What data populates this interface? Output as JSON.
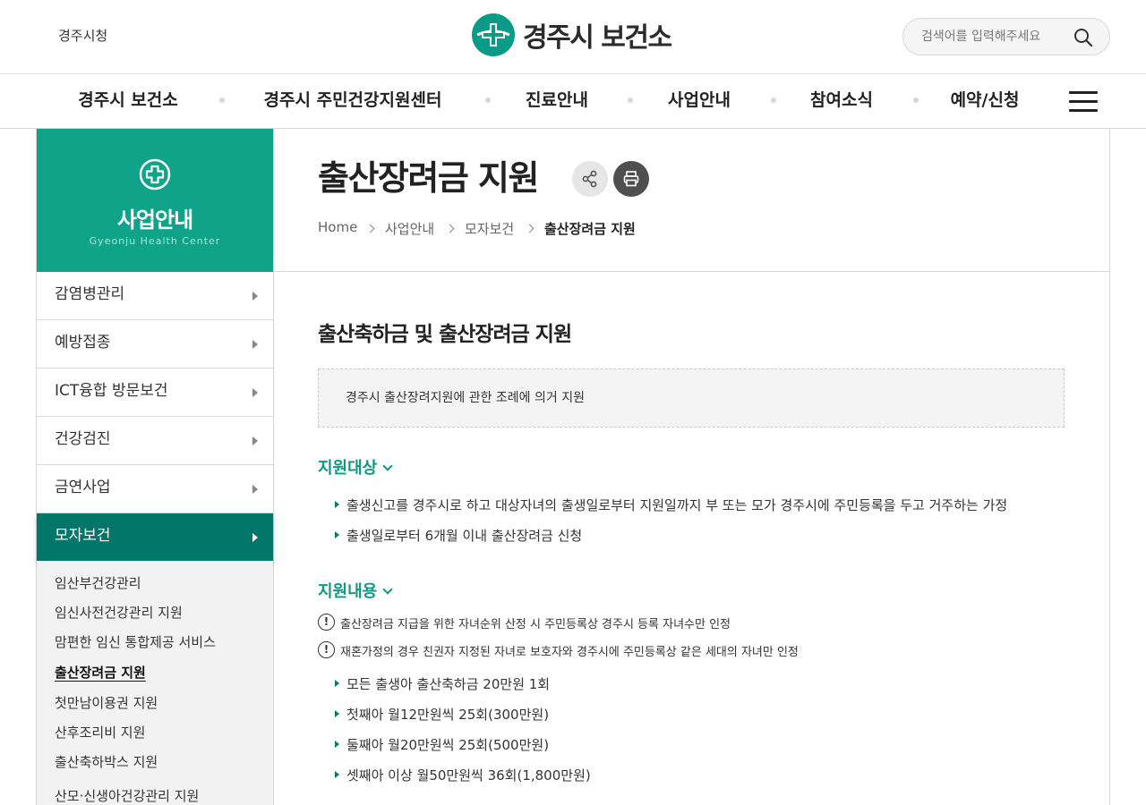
{
  "top": {
    "city_link": "경주시청",
    "logo_text": "경주시 보건소",
    "search_placeholder": "검색어를 입력해주세요"
  },
  "gnb": {
    "items": [
      "경주시 보건소",
      "경주시 주민건강지원센터",
      "진료안내",
      "사업안내",
      "참여소식",
      "예약/신청"
    ]
  },
  "sidebar": {
    "title": "사업안내",
    "subtitle": "Gyeonju Health Center",
    "items": [
      "감염병관리",
      "예방접종",
      "ICT융합 방문보건",
      "건강검진",
      "금연사업",
      "모자보건"
    ],
    "active_item": "모자보건",
    "sub_items": [
      "임산부건강관리",
      "임신사전건강관리 지원",
      "맘편한 임신 통합제공 서비스",
      "출산장려금 지원",
      "첫만남이용권 지원",
      "산후조리비 지원",
      "출산축하박스 지원",
      "산모·신생아건강관리 지원"
    ],
    "current_sub": "출산장려금 지원"
  },
  "page": {
    "title": "출산장려금 지원",
    "breadcrumb": [
      "Home",
      "사업안내",
      "모자보건",
      "출산장려금 지원"
    ]
  },
  "content": {
    "section_title": "출산축하금 및 출산장려금 지원",
    "law_text": "경주시 출산장려지원에 관한 조례에 의거 지원",
    "target": {
      "heading": "지원대상",
      "items": [
        "출생신고를 경주시로 하고 대상자녀의 출생일로부터 지원일까지 부 또는 모가 경주시에 주민등록을 두고 거주하는 가정",
        "출생일로부터 6개월 이내 출산장려금 신청"
      ]
    },
    "support": {
      "heading": "지원내용",
      "notes": [
        "출산장려금 지급을 위한 자녀순위 산정 시 주민등록상 경주시 등록 자녀수만 인정",
        "재혼가정의 경우 친권자 지정된 자녀로 보호자와 경주시에 주민등록상 같은 세대의 자녀만 인정"
      ],
      "note_icon": "!",
      "items": [
        "모든 출생아 출산축하금 20만원 1회",
        "첫째아 월12만원씩 25회(300만원)",
        "둘째아 월20만원씩 25회(500만원)",
        "셋째아 이상 월50만원씩 36회(1,800만원)"
      ]
    }
  },
  "colors": {
    "brand": "#0fa48a",
    "active": "#03766a",
    "accent_text": "#0a9a80"
  }
}
